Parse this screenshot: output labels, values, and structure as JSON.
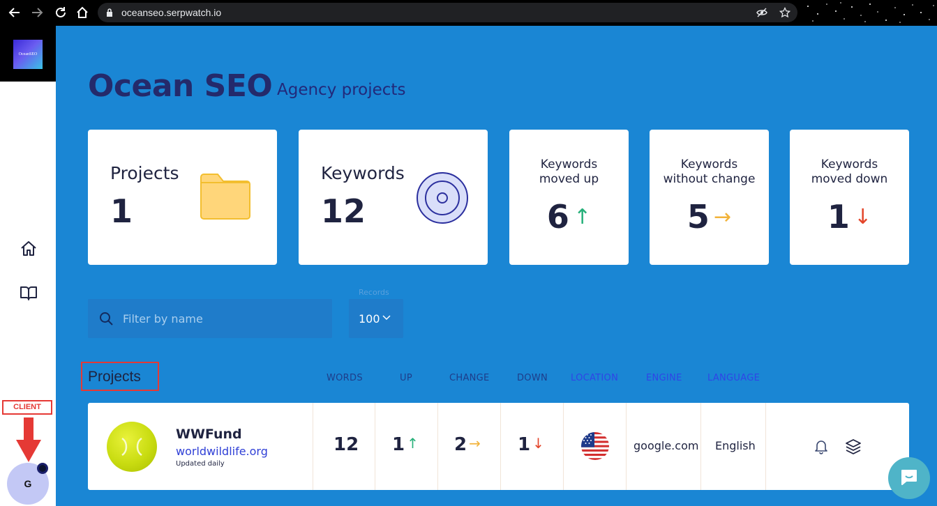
{
  "browser": {
    "url": "oceanseo.serpwatch.io",
    "icons": [
      "back-arrow-icon",
      "forward-arrow-icon",
      "reload-icon",
      "home-icon",
      "lock-icon",
      "eye-slash-icon",
      "star-icon"
    ]
  },
  "sidebar": {
    "logo_text": "OceanSEO",
    "nav_items": [
      "home-icon",
      "book-icon"
    ],
    "client_label": "CLIENT",
    "avatar_initial": "G"
  },
  "header": {
    "title": "Ocean SEO",
    "subtitle": "Agency projects"
  },
  "stats": {
    "projects": {
      "label": "Projects",
      "value": "1",
      "icon": "folder-icon"
    },
    "keywords": {
      "label": "Keywords",
      "value": "12",
      "icon": "target-icon"
    },
    "moved_up": {
      "label_line1": "Keywords",
      "label_line2": "moved up",
      "value": "6",
      "arrow": "↑"
    },
    "no_change": {
      "label_line1": "Keywords",
      "label_line2": "without change",
      "value": "5",
      "arrow": "→"
    },
    "moved_down": {
      "label_line1": "Keywords",
      "label_line2": "moved down",
      "value": "1",
      "arrow": "↓"
    }
  },
  "filters": {
    "search_placeholder": "Filter by name",
    "records_label": "Records",
    "records_value": "100"
  },
  "projects_table": {
    "heading": "Projects",
    "columns": [
      "WORDS",
      "UP",
      "CHANGE",
      "DOWN",
      "LOCATION",
      "ENGINE",
      "LANGUAGE"
    ],
    "rows": [
      {
        "name": "WWFund",
        "url": "worldwildlife.org",
        "updated": "Updated daily",
        "words": "12",
        "up": "1",
        "change": "2",
        "down": "1",
        "location_flag": "us-flag-icon",
        "engine": "google.com",
        "language": "English"
      }
    ]
  },
  "colors": {
    "background": "#1a86d4",
    "title": "#242a6b",
    "up": "#27b07a",
    "no_change": "#f2b33a",
    "down": "#e3452a",
    "link": "#2f3fd6"
  }
}
